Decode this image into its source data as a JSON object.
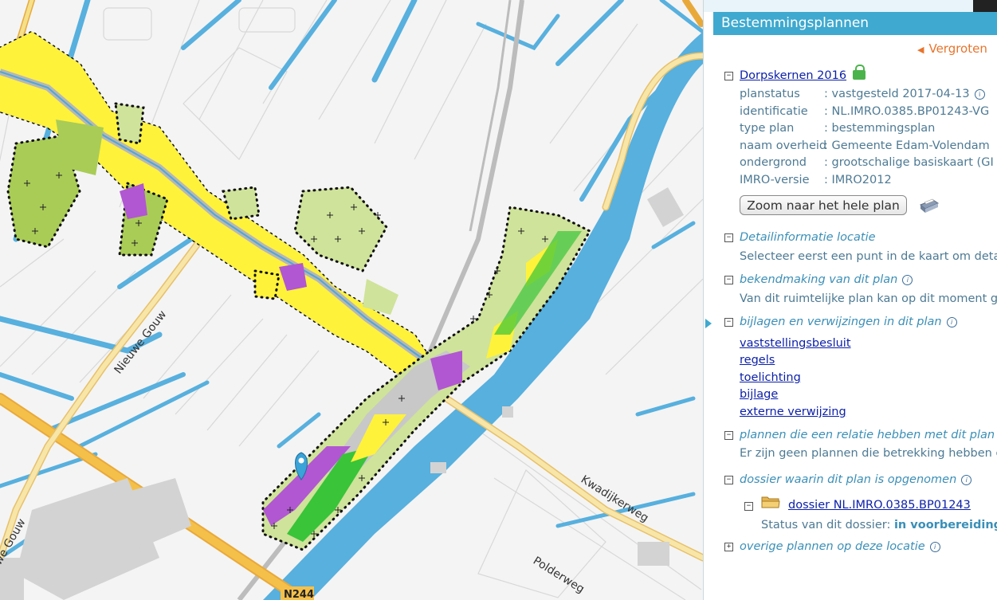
{
  "map": {
    "street_labels": {
      "nieuwe_gouw": "Nieuwe Gouw",
      "gouw_partial": "we Gouw",
      "kwadijkerweg": "Kwadijkerweg",
      "polderweg": "Polderweg",
      "n244": "N244"
    }
  },
  "panel": {
    "title": "Bestemmingsplannen",
    "expand_label": "Vergroten",
    "plan": {
      "name": "Dorpskernen 2016",
      "expand_symbol": "−",
      "properties": [
        {
          "key": "planstatus",
          "value": ": vastgesteld 2017-04-13",
          "info": true
        },
        {
          "key": "identificatie",
          "value": ": NL.IMRO.0385.BP01243-VG"
        },
        {
          "key": "type plan",
          "value": ": bestemmingsplan"
        },
        {
          "key": "naam overheid",
          "value": ": Gemeente Edam-Volendam"
        },
        {
          "key": "ondergrond",
          "value": ": grootschalige basiskaart (GI"
        },
        {
          "key": "IMRO-versie",
          "value": ": IMRO2012"
        }
      ],
      "zoom_button": "Zoom naar het hele plan"
    },
    "sections": {
      "detail": {
        "title": "Detailinformatie locatie",
        "text": "Selecteer eerst een punt in de kaart om detai"
      },
      "bekendmaking": {
        "title": "bekendmaking van dit plan",
        "text": "Van dit ruimtelijke plan kan op dit moment ge"
      },
      "bijlagen": {
        "title": "bijlagen en verwijzingen in dit plan",
        "links": [
          "vaststellingsbesluit",
          "regels",
          "toelichting",
          "bijlage",
          "externe verwijzing"
        ]
      },
      "relatie": {
        "title": "plannen die een relatie hebben met dit plan",
        "text": "Er zijn geen plannen die betrekking hebben o"
      },
      "dossier": {
        "title": "dossier waarin dit plan is opgenomen",
        "link": "dossier NL.IMRO.0385.BP01243",
        "status_label": "Status van dit dossier:",
        "status_value": "in voorbereiding"
      },
      "overige": {
        "title": "overige plannen op deze locatie",
        "expand_symbol": "+"
      }
    }
  },
  "colors": {
    "water": "#57b0de",
    "road_major": "#f5c04a",
    "plan_yellow": "#fff23b",
    "plan_green_light": "#cfe39a",
    "plan_green": "#a9cc57",
    "plan_purple": "#b157d2",
    "plan_bright_green": "#39c439",
    "header_blue": "#3fa9cf",
    "link_blue": "#0b1fa8",
    "section_blue": "#3a8fb7"
  }
}
